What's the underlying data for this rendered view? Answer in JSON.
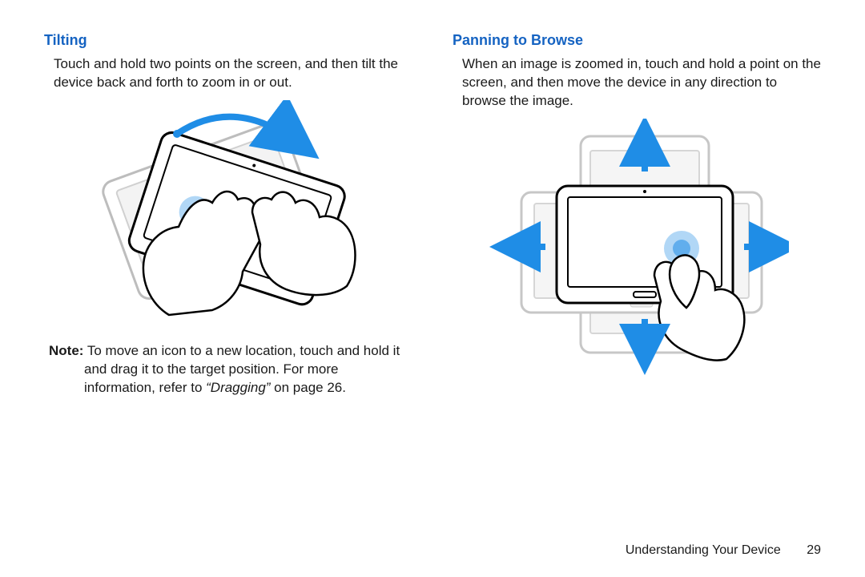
{
  "left": {
    "heading": "Tilting",
    "body": "Touch and hold two points on the screen, and then tilt the device back and forth to zoom in or out.",
    "note_label": "Note:",
    "note_body_a": " To move an icon to a new location, touch and hold it and drag it to the target position. For more information, refer to ",
    "note_ref_italic": "“Dragging”",
    "note_body_b": " on page 26."
  },
  "right": {
    "heading": "Panning to Browse",
    "body": "When an image is zoomed in, touch and hold a point on the screen, and then move the device in any direction to browse the image."
  },
  "footer": {
    "section": "Understanding Your Device",
    "page": "29"
  }
}
